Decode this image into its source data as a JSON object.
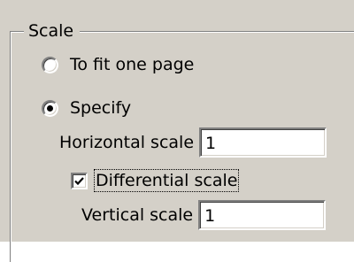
{
  "group": {
    "title": "Scale"
  },
  "scale_mode": {
    "options": [
      {
        "label": "To fit one page",
        "selected": false
      },
      {
        "label": "Specify",
        "selected": true
      }
    ]
  },
  "horizontal_scale": {
    "label": "Horizontal scale",
    "value": "1"
  },
  "differential_scale": {
    "label": "Differential scale",
    "checked": true
  },
  "vertical_scale": {
    "label": "Vertical scale",
    "value": "1"
  },
  "icons": {
    "radio_unselected": "radio-empty-icon",
    "radio_selected": "radio-dot-icon",
    "checkbox_checked": "check-mark-icon"
  },
  "colors": {
    "dialog_background": "#d4d0c8",
    "field_background": "#ffffff",
    "shadow": "#808080"
  }
}
